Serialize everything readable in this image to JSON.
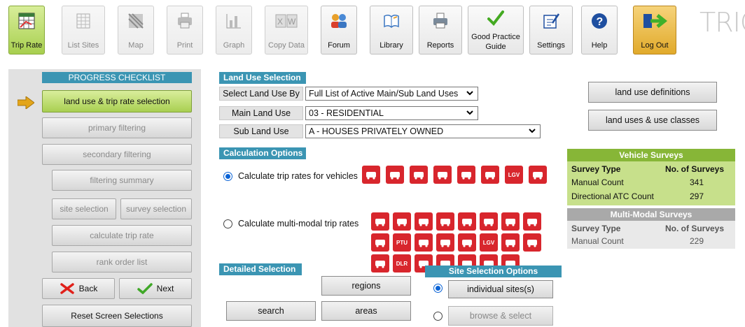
{
  "toolbar": {
    "buttons": [
      {
        "label": "Trip Rate",
        "icon": "trip-rate-icon"
      },
      {
        "label": "List Sites",
        "icon": "list-sites-icon"
      },
      {
        "label": "Map",
        "icon": "map-icon"
      },
      {
        "label": "Print",
        "icon": "print-icon"
      },
      {
        "label": "Graph",
        "icon": "graph-icon"
      },
      {
        "label": "Copy Data",
        "icon": "copy-data-icon"
      },
      {
        "label": "Forum",
        "icon": "forum-icon"
      },
      {
        "label": "Library",
        "icon": "library-icon"
      },
      {
        "label": "Reports",
        "icon": "reports-icon"
      },
      {
        "label": "Good Practice Guide",
        "icon": "checkmark-icon"
      },
      {
        "label": "Settings",
        "icon": "settings-icon"
      },
      {
        "label": "Help",
        "icon": "help-icon"
      },
      {
        "label": "Log Out",
        "icon": "log-out-icon"
      }
    ],
    "logo": "TRIC"
  },
  "checklist": {
    "title": "PROGRESS CHECKLIST",
    "items": {
      "land_use": "land use & trip rate selection",
      "primary": "primary filtering",
      "secondary": "secondary filtering",
      "summary": "filtering summary",
      "site": "site selection",
      "survey": "survey selection",
      "calculate": "calculate trip rate",
      "rank": "rank order list"
    },
    "back": "Back",
    "next": "Next",
    "reset": "Reset Screen Selections"
  },
  "land_use": {
    "title": "Land Use Selection",
    "select_by_label": "Select Land Use By",
    "select_by_value": "Full List of Active Main/Sub Land Uses",
    "main_label": "Main Land Use",
    "main_value": "03 - RESIDENTIAL",
    "sub_label": "Sub Land Use",
    "sub_value": "A - HOUSES PRIVATELY OWNED",
    "definitions_button": "land use definitions",
    "classes_button": "land uses & use classes"
  },
  "calculation": {
    "title": "Calculation Options",
    "vehicles": "Calculate trip rates for vehicles",
    "multimodal": "Calculate multi-modal trip rates",
    "selected": "vehicles",
    "mode_icons": [
      "taxi",
      "bus",
      "coach",
      "cycle",
      "car",
      "car-front",
      "lgv",
      "motorcycle",
      "taxi",
      "bus",
      "coach",
      "cycle",
      "pedestrian",
      "rail",
      "tram",
      "people",
      "rail",
      "ptu",
      "bus-stop",
      "taxi",
      "car",
      "lgv",
      "motorcycle",
      "tram",
      "underground",
      "dlr",
      "train",
      "swap",
      "bus-stop",
      "tram",
      "ship"
    ],
    "mode_text": {
      "lgv": "LGV",
      "ptu": "PTU",
      "dlr": "DLR"
    }
  },
  "vehicle_surveys": {
    "title": "Vehicle Surveys",
    "col1": "Survey Type",
    "col2": "No. of Surveys",
    "rows": [
      {
        "type": "Manual Count",
        "count": "341"
      },
      {
        "type": "Directional ATC Count",
        "count": "297"
      }
    ]
  },
  "multi_modal_surveys": {
    "title": "Multi-Modal Surveys",
    "col1": "Survey Type",
    "col2": "No. of Surveys",
    "rows": [
      {
        "type": "Manual Count",
        "count": "229"
      }
    ]
  },
  "detailed": {
    "title": "Detailed Selection",
    "regions": "regions",
    "search": "search",
    "areas": "areas"
  },
  "site_options": {
    "title": "Site Selection Options",
    "individual": "individual sites(s)",
    "browse": "browse & select",
    "selected": "individual"
  },
  "colors": {
    "accent_blue": "#3b95b3",
    "active_green": "#a9cf51",
    "vehicle_green": "#87b637",
    "mode_red": "#d8262d"
  }
}
